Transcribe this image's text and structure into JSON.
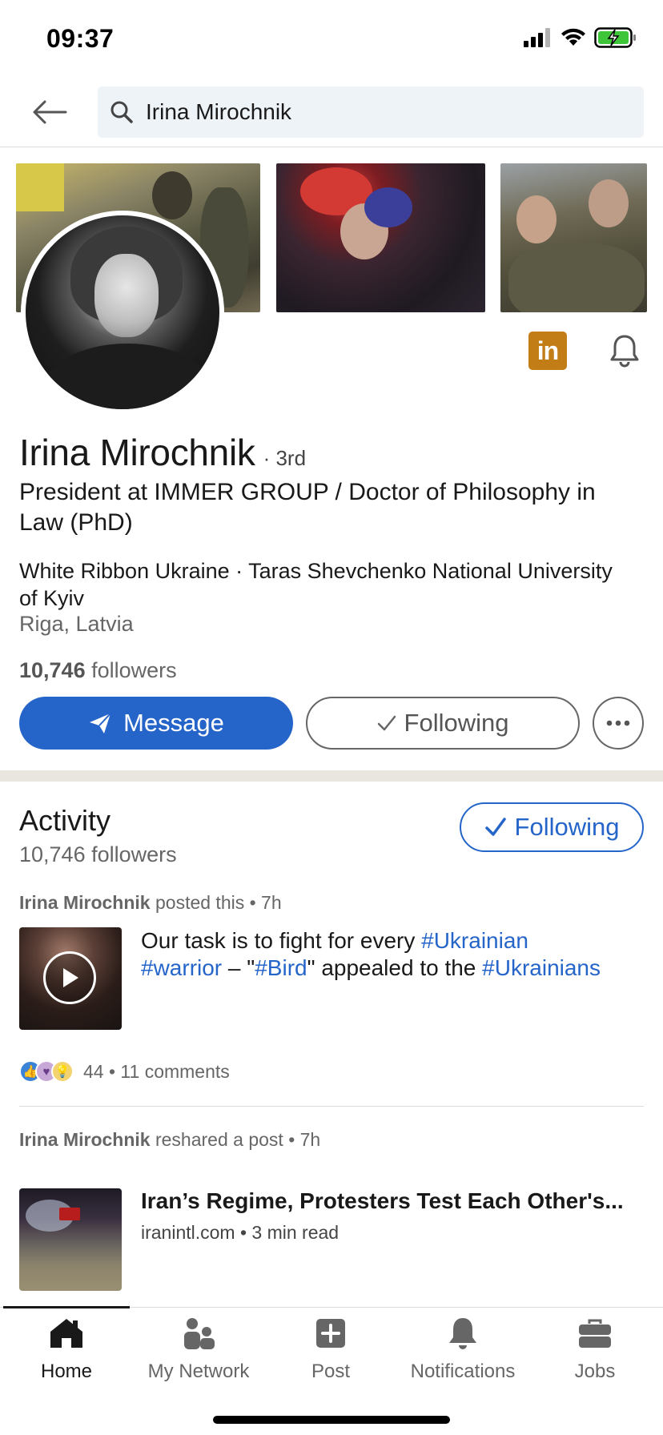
{
  "status_bar": {
    "time": "09:37"
  },
  "search": {
    "query": "Irina Mirochnik"
  },
  "profile": {
    "name": "Irina Mirochnik",
    "degree": "· 3rd",
    "headline": "President at IMMER GROUP / Doctor of Philosophy in Law (PhD)",
    "education": "White Ribbon Ukraine · Taras Shevchenko National University of Kyiv",
    "location": "Riga, Latvia",
    "followers_count": "10,746",
    "followers_label": " followers",
    "linkedin_badge": "in"
  },
  "actions": {
    "message_label": "Message",
    "following_label": "Following"
  },
  "activity": {
    "title": "Activity",
    "followers": "10,746 followers",
    "follow_button": "Following",
    "posts": [
      {
        "author": "Irina Mirochnik",
        "action": " posted this • 7h",
        "text_parts": [
          "Our task is to fight for every ",
          "#Ukrainian",
          " ",
          "#warrior",
          " – \"",
          "#Bird",
          "\" appealed to the ",
          "#Ukrainians"
        ],
        "reactions_count": "44",
        "comments": "• 11 comments"
      },
      {
        "author": "Irina Mirochnik",
        "action": " reshared a post • 7h",
        "article_title": "Iran’s Regime, Protesters Test Each Other's...",
        "article_source": "iranintl.com • 3 min read"
      }
    ]
  },
  "nav": [
    {
      "label": "Home",
      "icon": "home-icon",
      "active": true
    },
    {
      "label": "My Network",
      "icon": "network-icon",
      "active": false
    },
    {
      "label": "Post",
      "icon": "post-icon",
      "active": false
    },
    {
      "label": "Notifications",
      "icon": "bell-icon",
      "active": false
    },
    {
      "label": "Jobs",
      "icon": "briefcase-icon",
      "active": false
    }
  ],
  "colors": {
    "brand_blue": "#2565c9",
    "linkedin_badge": "#c37d16",
    "divider": "#e9e5df"
  }
}
